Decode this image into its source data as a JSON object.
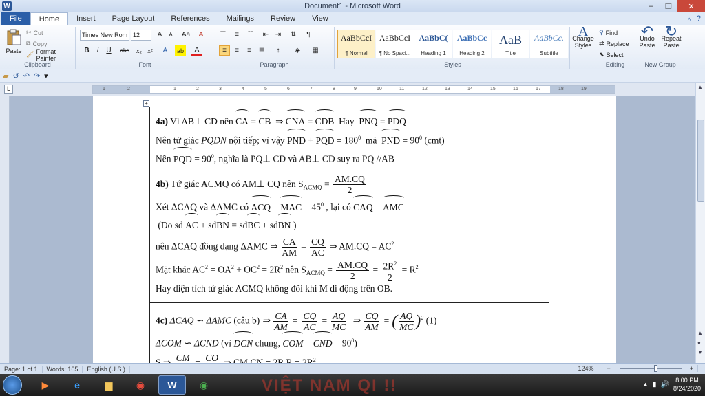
{
  "window": {
    "title": "Document1 - Microsoft Word",
    "app_letter": "W",
    "minimize": "–",
    "maximize": "❐",
    "close": "✕"
  },
  "tabs": [
    "File",
    "Home",
    "Insert",
    "Page Layout",
    "References",
    "Mailings",
    "Review",
    "View"
  ],
  "active_tab": "Home",
  "ribbon": {
    "clipboard": {
      "label": "Clipboard",
      "paste": "Paste",
      "cut": "Cut",
      "copy": "Copy",
      "format_painter": "Format Painter"
    },
    "font": {
      "label": "Font",
      "family": "Times New Rom",
      "size": "12",
      "grow": "A",
      "shrink": "A",
      "change_case": "Aa",
      "clear": "A",
      "bold": "B",
      "italic": "I",
      "underline": "U",
      "strike": "abc",
      "subscript": "x₂",
      "superscript": "x²",
      "effects": "A",
      "highlight": "ab",
      "color": "A"
    },
    "paragraph": {
      "label": "Paragraph"
    },
    "styles": {
      "label": "Styles",
      "items": [
        {
          "sample": "AaBbCcI",
          "name": "¶ Normal"
        },
        {
          "sample": "AaBbCcI",
          "name": "¶ No Spaci..."
        },
        {
          "sample": "AaBbC(",
          "name": "Heading 1"
        },
        {
          "sample": "AaBbCc",
          "name": "Heading 2"
        },
        {
          "sample": "AaB",
          "name": "Title"
        },
        {
          "sample": "AaBbCc.",
          "name": "Subtitle"
        }
      ],
      "change_styles": "Change Styles"
    },
    "editing": {
      "label": "Editing",
      "find": "Find",
      "replace": "Replace",
      "select": "Select"
    },
    "new_group": {
      "label": "New Group",
      "undo_paste": "Undo Paste",
      "repeat_paste": "Repeat Paste"
    }
  },
  "ruler": {
    "tab_selector": "L",
    "numbers": [
      "1",
      "2",
      "1",
      "2",
      "3",
      "4",
      "5",
      "6",
      "7",
      "8",
      "9",
      "10",
      "11",
      "12",
      "13",
      "14",
      "15",
      "16",
      "17",
      "18",
      "19"
    ]
  },
  "status": {
    "page": "Page: 1 of 1",
    "words": "Words: 165",
    "language": "English (U.S.)",
    "zoom": "124%"
  },
  "taskbar": {
    "time": "8:00 PM",
    "date": "8/24/2020",
    "watermark": "VIỆT NAM QI !!",
    "word_letter": "W"
  },
  "doc": {
    "a_label": "4a)",
    "a1_1": "Vì AB",
    "a1_2": " CD  nên ",
    "a1_arc_ca": "CA",
    "a1_arc_cb": "CB",
    "a1_arc_cna": "CNA",
    "a1_arc_cdb": "CDB",
    "a1_hay": "Hay",
    "a1_arc_pnq": "PNQ",
    "a1_arc_pdq": "PDQ",
    "a2_1": "Nên tứ giác ",
    "a2_pqdn": "PQDN",
    "a2_2": " nội tiếp;  vì vậy ",
    "a2_arc_pnd": "PND",
    "a2_arc_pqd": "PQD",
    "a2_180": "180",
    "a2_ma": "mà",
    "a2_arc_pnd2": "PND",
    "a2_90": "90",
    "a2_cmt": "(cmt)",
    "a3_1": "Nên ",
    "a3_arc_pqd": "PQD",
    "a3_90": "90",
    "a3_2": ", nghĩa là PQ",
    "a3_3": " CD và AB",
    "a3_4": " CD suy ra PQ //AB",
    "b_label": "4b)",
    "b1_1": "Tứ giác ACMQ có AM",
    "b1_2": " CQ nên S",
    "b1_sub": "ACMQ",
    "b1_num": "AM.CQ",
    "b1_den": "2",
    "b2_1": "Xét  ΔCAQ  và ΔAMC có ",
    "b2_arc_acq": "ACQ",
    "b2_arc_mac": "MAC",
    "b2_45": "45",
    "b2_2": ", lại có ",
    "b2_arc_caq": "CAQ",
    "b2_arc_amc": "AMC",
    "b3_1": "(Do  sđ",
    "b3_arc_ac": "AC",
    "b3_2": " + sđ",
    "b3_arc_bn": "BN",
    "b3_3": " = sđ",
    "b3_arc_bc": "BC",
    "b3_4": " + sđ",
    "b3_arc_bn2": "BN",
    "b3_5": " )",
    "b4_1": "nên ΔCAQ  đồng dạng ΔAMC ",
    "b4_n1": "CA",
    "b4_d1": "AM",
    "b4_n2": "CQ",
    "b4_d2": "AC",
    "b4_2": "AM.CQ = AC",
    "b5_1": "Mặt khác  AC",
    "b5_2": " = OA",
    "b5_3": " + OC",
    "b5_4": " = 2R",
    "b5_5": "  nên S",
    "b5_sub": "ACMQ",
    "b5_n1": "AM.CQ",
    "b5_d1": "2",
    "b5_n2": "2R",
    "b5_d2": "2",
    "b5_6": "= R",
    "b6": "Hay diện tích tứ giác ACMQ không đổi khi M di động trên OB.",
    "c_label": "4c)",
    "c1_1": "ΔCAQ",
    "c1_sim": "∽",
    "c1_2": "ΔAMC",
    "c1_3": "(câu b)",
    "c1_n1": "CA",
    "c1_d1": "AM",
    "c1_n2": "CQ",
    "c1_d2": "AC",
    "c1_n3": "AQ",
    "c1_d3": "MC",
    "c1_n4": "CQ",
    "c1_d4": "AM",
    "c1_n5": "AQ",
    "c1_d5": "MC",
    "c1_one": "(1)",
    "c2_1": "ΔCOM",
    "c2_2": "ΔCND",
    "c2_3": "(vì ",
    "c2_arc_dcn": "DCN",
    "c2_4": " chung, ",
    "c2_arc_com": "COM",
    "c2_arc_cnd": "CND",
    "c2_90": "90",
    "c2_5": ")",
    "c3_1": "S",
    "c3_n1": "CM",
    "c3_n2": "CO",
    "c3_2": "CM.CN = 2R.R = 2R"
  }
}
